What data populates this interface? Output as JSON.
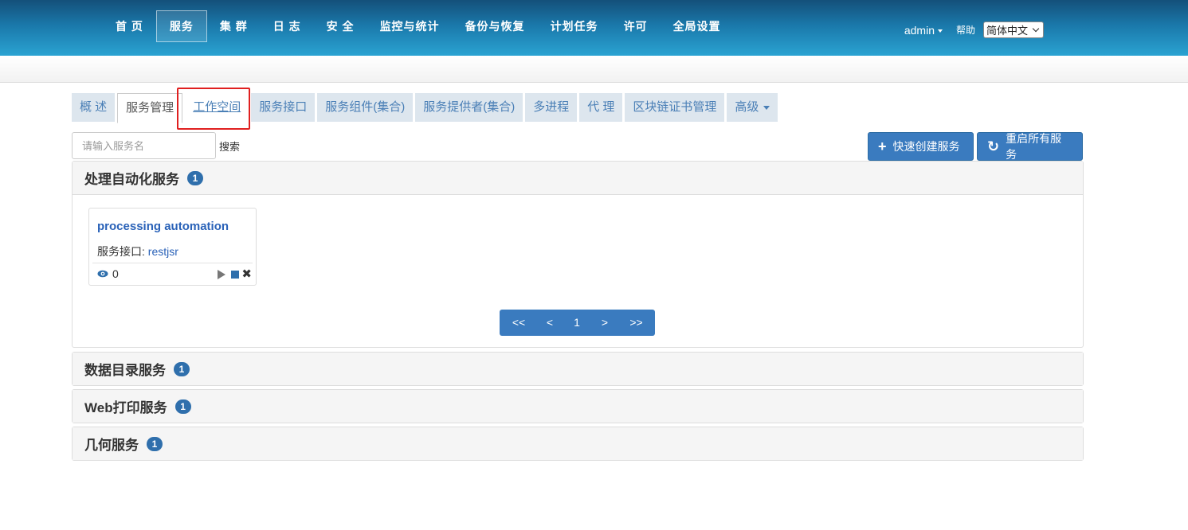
{
  "nav": {
    "items": [
      {
        "label": "首 页",
        "active": false
      },
      {
        "label": "服务",
        "active": true
      },
      {
        "label": "集 群",
        "active": false
      },
      {
        "label": "日 志",
        "active": false
      },
      {
        "label": "安 全",
        "active": false
      },
      {
        "label": "监控与统计",
        "active": false
      },
      {
        "label": "备份与恢复",
        "active": false
      },
      {
        "label": "计划任务",
        "active": false
      },
      {
        "label": "许可",
        "active": false
      },
      {
        "label": "全局设置",
        "active": false
      }
    ],
    "user": "admin",
    "help": "帮助",
    "language": "简体中文"
  },
  "tabs": [
    {
      "label": "概 述"
    },
    {
      "label": "服务管理"
    },
    {
      "label": "工作空间"
    },
    {
      "label": "服务接口"
    },
    {
      "label": "服务组件(集合)"
    },
    {
      "label": "服务提供者(集合)"
    },
    {
      "label": "多进程"
    },
    {
      "label": "代 理"
    },
    {
      "label": "区块链证书管理"
    },
    {
      "label": "高级"
    }
  ],
  "search": {
    "placeholder": "请输入服务名",
    "button": "搜索"
  },
  "actions": {
    "create": "快速创建服务",
    "restart": "重启所有服务"
  },
  "panels": [
    {
      "title": "处理自动化服务",
      "count": "1"
    },
    {
      "title": "数据目录服务",
      "count": "1"
    },
    {
      "title": "Web打印服务",
      "count": "1"
    },
    {
      "title": "几何服务",
      "count": "1"
    }
  ],
  "card": {
    "title": "processing automation",
    "iface_label": "服务接口:",
    "iface_value": "restjsr",
    "views": "0"
  },
  "pager": {
    "first": "<<",
    "prev": "<",
    "current": "1",
    "next": ">",
    "last": ">>"
  },
  "colors": {
    "accent": "#3a7bbf",
    "highlight": "#e02020",
    "link": "#2a62b8"
  }
}
